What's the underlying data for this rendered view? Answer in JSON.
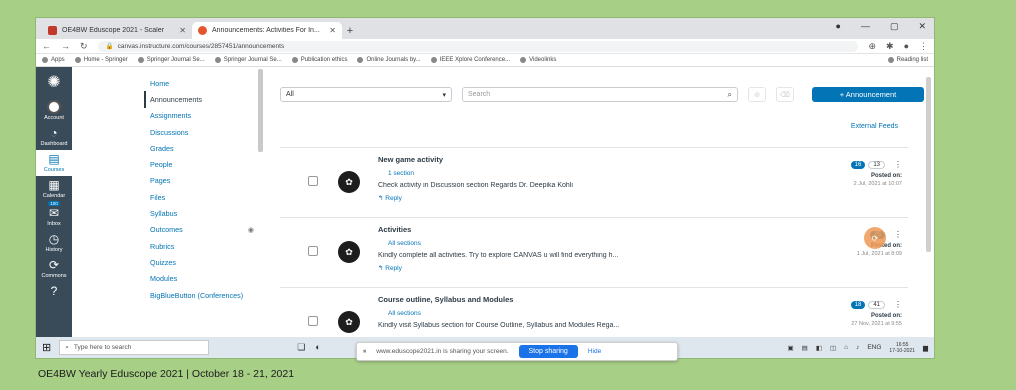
{
  "browser": {
    "tabs": [
      {
        "title": "OE4BW Eduscope 2021 - Scaler",
        "favicon_color": "#c0392b",
        "active": false
      },
      {
        "title": "Announcements: Activities For In...",
        "favicon_color": "#e4572e",
        "active": true
      }
    ],
    "url": "canvas.instructure.com/courses/2857451/announcements",
    "bookmarks": [
      "Apps",
      "Home - Springer",
      "Springer Journal Se...",
      "Springer Journal Se...",
      "Publication ethics",
      "Online Journals by...",
      "IEEE Xplore Conference...",
      "Videolinks"
    ],
    "reading_list": "Reading list"
  },
  "global_nav": [
    {
      "label": "Account",
      "icon": "avatar-icon"
    },
    {
      "label": "Dashboard",
      "icon": "dashboard-icon",
      "glyph": "◔"
    },
    {
      "label": "Courses",
      "icon": "courses-icon",
      "glyph": "▤",
      "active": true
    },
    {
      "label": "Calendar",
      "icon": "calendar-icon",
      "glyph": "▦"
    },
    {
      "label": "Inbox",
      "icon": "inbox-icon",
      "glyph": "✉",
      "badge": "100"
    },
    {
      "label": "History",
      "icon": "history-icon",
      "glyph": "◷"
    },
    {
      "label": "Commons",
      "icon": "commons-icon",
      "glyph": "⟳"
    },
    {
      "label": "",
      "icon": "help-icon",
      "glyph": "?"
    }
  ],
  "course_nav": [
    {
      "label": "Home"
    },
    {
      "label": "Announcements",
      "active": true
    },
    {
      "label": "Assignments"
    },
    {
      "label": "Discussions"
    },
    {
      "label": "Grades"
    },
    {
      "label": "People"
    },
    {
      "label": "Pages"
    },
    {
      "label": "Files"
    },
    {
      "label": "Syllabus"
    },
    {
      "label": "Outcomes",
      "hidden_eye": true
    },
    {
      "label": "Rubrics"
    },
    {
      "label": "Quizzes"
    },
    {
      "label": "Modules"
    },
    {
      "label": "BigBlueButton (Conferences)"
    }
  ],
  "toolbar": {
    "filter_value": "All",
    "search_placeholder": "Search",
    "add_label": "+ Announcement",
    "external_feeds": "External Feeds"
  },
  "announcements": [
    {
      "title": "New game activity",
      "section": "1 section",
      "message": "Check activity in Discussion section Regards Dr. Deepika Kohli",
      "reply": "↰ Reply",
      "unread": "16",
      "total": "13",
      "posted_label": "Posted on:",
      "date": "2 Jul, 2021 at 10:07"
    },
    {
      "title": "Activities",
      "section": "All sections",
      "message": "Kindly complete all activities. Try to explore CANVAS u will find everything h...",
      "reply": "↰ Reply",
      "unread": "25",
      "total": "",
      "posted_label": "Posted on:",
      "date": "1 Jul, 2021 at 8:09"
    },
    {
      "title": "Course outline, Syllabus and Modules",
      "section": "All sections",
      "message": "Kindly visit Syllabus section for Course Outline, Syllabus and Modules Rega...",
      "reply": "",
      "unread": "18",
      "total": "41",
      "posted_label": "Posted on:",
      "date": "27 Nov, 2021 at 9:55"
    }
  ],
  "taskbar": {
    "search_placeholder": "Type here to search",
    "lang": "ENG",
    "time": "16:55",
    "date": "17-10-2021"
  },
  "share_bar": {
    "message": "www.eduscope2021.in is sharing your screen.",
    "stop_label": "Stop sharing",
    "hide_label": "Hide"
  },
  "caption": "OE4BW Yearly Eduscope 2021 | October 18 - 21, 2021"
}
